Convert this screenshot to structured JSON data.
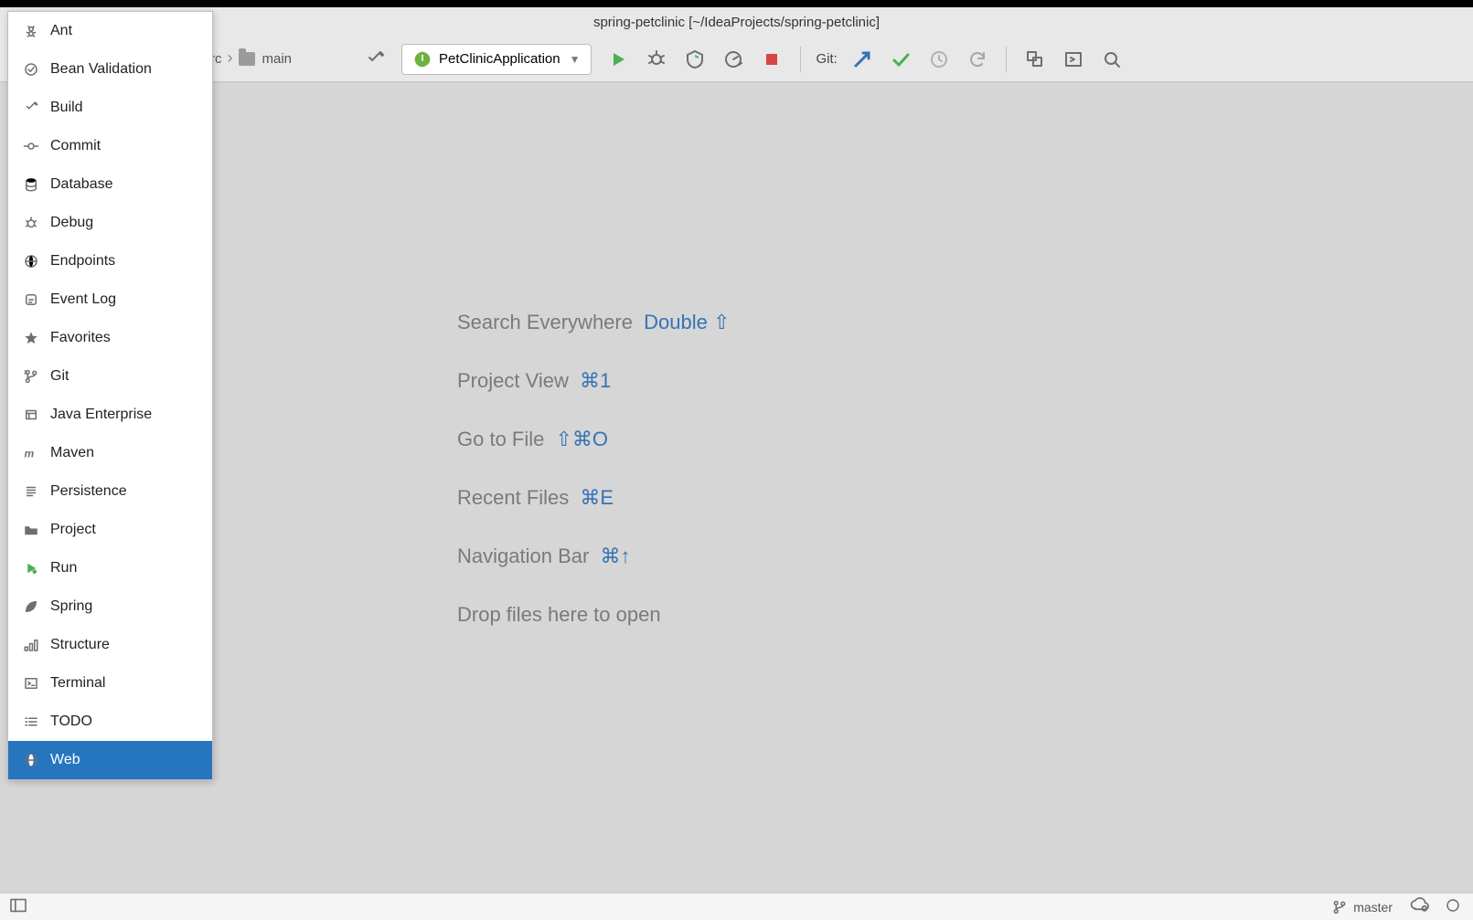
{
  "title": "spring-petclinic [~/IdeaProjects/spring-petclinic]",
  "breadcrumb": {
    "partial_rc": "rc",
    "main": "main"
  },
  "run_config": {
    "selected": "PetClinicApplication"
  },
  "toolbar": {
    "git_label": "Git:"
  },
  "popup": {
    "items": [
      {
        "label": "Ant",
        "icon": "ant-icon"
      },
      {
        "label": "Bean Validation",
        "icon": "bean-validation-icon"
      },
      {
        "label": "Build",
        "icon": "hammer-icon"
      },
      {
        "label": "Commit",
        "icon": "commit-icon"
      },
      {
        "label": "Database",
        "icon": "database-icon"
      },
      {
        "label": "Debug",
        "icon": "bug-icon"
      },
      {
        "label": "Endpoints",
        "icon": "globe-icon"
      },
      {
        "label": "Event Log",
        "icon": "event-log-icon"
      },
      {
        "label": "Favorites",
        "icon": "star-icon"
      },
      {
        "label": "Git",
        "icon": "git-branch-icon"
      },
      {
        "label": "Java Enterprise",
        "icon": "java-enterprise-icon"
      },
      {
        "label": "Maven",
        "icon": "maven-icon"
      },
      {
        "label": "Persistence",
        "icon": "persistence-icon"
      },
      {
        "label": "Project",
        "icon": "folder-icon"
      },
      {
        "label": "Run",
        "icon": "play-icon"
      },
      {
        "label": "Spring",
        "icon": "spring-leaf-icon"
      },
      {
        "label": "Structure",
        "icon": "structure-icon"
      },
      {
        "label": "Terminal",
        "icon": "terminal-icon"
      },
      {
        "label": "TODO",
        "icon": "todo-list-icon"
      },
      {
        "label": "Web",
        "icon": "globe-icon",
        "selected": true
      }
    ]
  },
  "hints": [
    {
      "label": "Search Everywhere",
      "shortcut": "Double ⇧"
    },
    {
      "label": "Project View",
      "shortcut": "⌘1"
    },
    {
      "label": "Go to File",
      "shortcut": "⇧⌘O"
    },
    {
      "label": "Recent Files",
      "shortcut": "⌘E"
    },
    {
      "label": "Navigation Bar",
      "shortcut": "⌘↑"
    },
    {
      "label": "Drop files here to open",
      "shortcut": ""
    }
  ],
  "status": {
    "branch": "master"
  }
}
